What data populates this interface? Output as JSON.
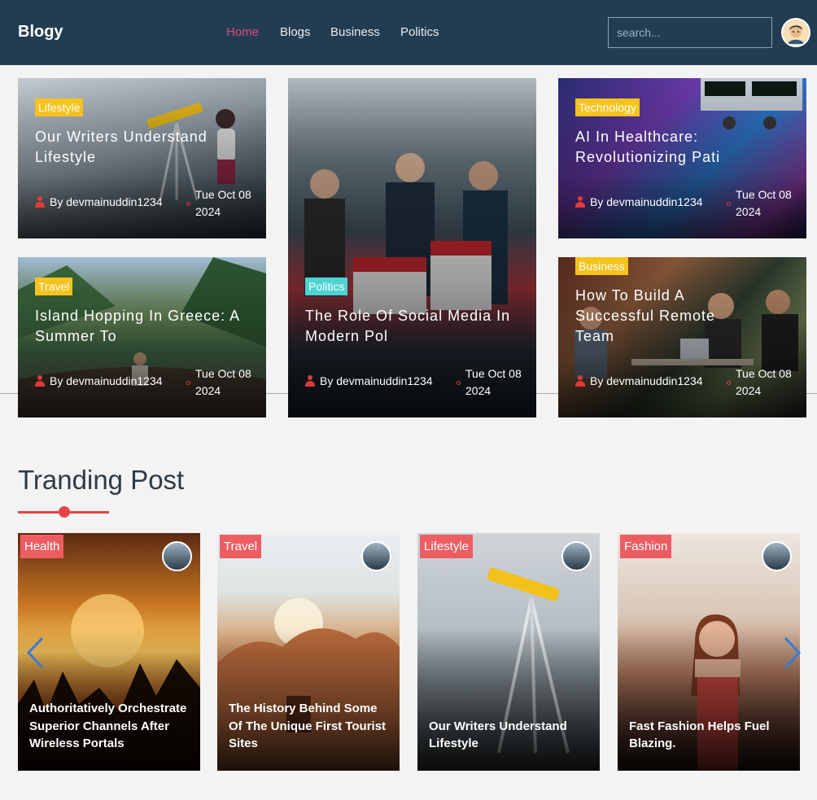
{
  "header": {
    "logo": "Blogy",
    "nav": [
      "Home",
      "Blogs",
      "Business",
      "Politics"
    ],
    "search_placeholder": "search..."
  },
  "featured": [
    {
      "category": "Lifestyle",
      "category_color": "#f5c31d",
      "title": "Our Writers Understand Lifestyle",
      "author": "By devmainuddin1234",
      "date": "Tue Oct 08 2024"
    },
    {
      "category": "Politics",
      "category_color": "#4ed3d3",
      "title": "The Role Of Social Media In Modern Pol",
      "author": "By devmainuddin1234",
      "date": "Tue Oct 08 2024"
    },
    {
      "category": "Technology",
      "category_color": "#f5c31d",
      "title": "AI In Healthcare: Revolutionizing Pati",
      "author": "By devmainuddin1234",
      "date": "Tue Oct 08 2024"
    },
    {
      "category": "Travel",
      "category_color": "#f5c31d",
      "title": "Island Hopping In Greece: A Summer To",
      "author": "By devmainuddin1234",
      "date": "Tue Oct 08 2024"
    },
    {
      "category": "Business",
      "category_color": "#f5c31d",
      "title": "How To Build A Successful Remote Team",
      "author": "By devmainuddin1234",
      "date": "Tue Oct 08 2024"
    }
  ],
  "trending": {
    "heading": "Tranding Post",
    "posts": [
      {
        "category": "Health",
        "title": "Authoritatively Orchestrate Superior Channels After Wireless Portals"
      },
      {
        "category": "Travel",
        "title": "The History Behind Some Of The Unique First Tourist Sites"
      },
      {
        "category": "Lifestyle",
        "title": "Our Writers Understand Lifestyle"
      },
      {
        "category": "Fashion",
        "title": "Fast Fashion Helps Fuel Blazing."
      }
    ]
  },
  "colors": {
    "header_bg": "#223d52",
    "active_nav": "#e0467a",
    "accent": "#e54447",
    "badge_trending": "#ec5d62"
  }
}
